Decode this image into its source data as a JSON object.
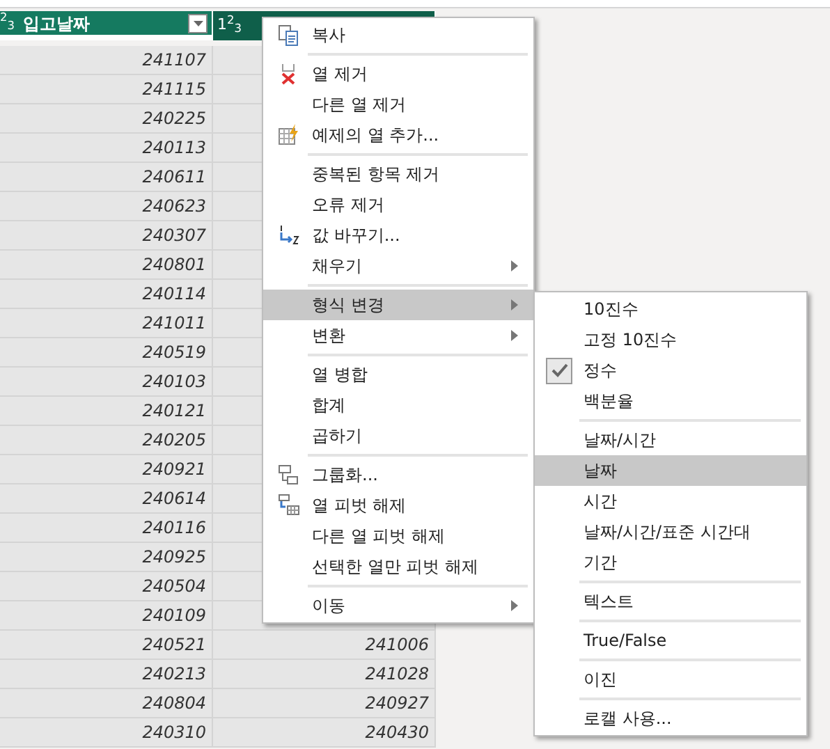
{
  "table": {
    "columns": [
      {
        "type_badge": "$^{2}$$_{3}$",
        "label": "입고날짜"
      },
      {
        "type_badge": "1$^{2}$$_{3}$"
      }
    ],
    "rows": [
      {
        "cells": [
          "241107"
        ]
      },
      {
        "cells": [
          "241115"
        ]
      },
      {
        "cells": [
          "240225"
        ]
      },
      {
        "cells": [
          "240113"
        ]
      },
      {
        "cells": [
          "240611"
        ]
      },
      {
        "cells": [
          "240623"
        ]
      },
      {
        "cells": [
          "240307"
        ]
      },
      {
        "cells": [
          "240801"
        ]
      },
      {
        "cells": [
          "240114"
        ]
      },
      {
        "cells": [
          "241011"
        ]
      },
      {
        "cells": [
          "240519"
        ]
      },
      {
        "cells": [
          "240103"
        ]
      },
      {
        "cells": [
          "240121"
        ]
      },
      {
        "cells": [
          "240205"
        ]
      },
      {
        "cells": [
          "240921"
        ]
      },
      {
        "cells": [
          "240614"
        ]
      },
      {
        "cells": [
          "240116"
        ]
      },
      {
        "cells": [
          "240925"
        ]
      },
      {
        "cells": [
          "240504"
        ]
      },
      {
        "cells": [
          "240109"
        ]
      },
      {
        "cells": [
          "240521",
          "241006"
        ]
      },
      {
        "cells": [
          "240213",
          "241028"
        ]
      },
      {
        "cells": [
          "240804",
          "240927"
        ]
      },
      {
        "cells": [
          "240310",
          "240430"
        ]
      }
    ]
  },
  "context_menu": {
    "groups": [
      [
        {
          "label": "복사",
          "kind": "copy",
          "submenu": false,
          "selected": false
        }
      ],
      [
        {
          "label": "열 제거",
          "kind": "delete",
          "submenu": false,
          "selected": false
        },
        {
          "label": "다른 열 제거",
          "kind": "plain",
          "submenu": false,
          "selected": false
        },
        {
          "label": "예제의 열 추가...",
          "kind": "example",
          "submenu": false,
          "selected": false
        }
      ],
      [
        {
          "label": "중복된 항목 제거",
          "kind": "plain",
          "submenu": false,
          "selected": false
        },
        {
          "label": "오류 제거",
          "kind": "plain",
          "submenu": false,
          "selected": false
        },
        {
          "label": "값 바꾸기...",
          "kind": "replace",
          "submenu": false,
          "selected": false
        },
        {
          "label": "채우기",
          "kind": "plain",
          "submenu": true,
          "selected": false
        }
      ],
      [
        {
          "label": "형식 변경",
          "kind": "plain",
          "submenu": true,
          "selected": true
        },
        {
          "label": "변환",
          "kind": "plain",
          "submenu": true,
          "selected": false
        }
      ],
      [
        {
          "label": "열 병합",
          "kind": "plain",
          "submenu": false,
          "selected": false
        },
        {
          "label": "합계",
          "kind": "plain",
          "submenu": false,
          "selected": false
        },
        {
          "label": "곱하기",
          "kind": "plain",
          "submenu": false,
          "selected": false
        }
      ],
      [
        {
          "label": "그룹화...",
          "kind": "group",
          "submenu": false,
          "selected": false
        },
        {
          "label": "열 피벗 해제",
          "kind": "unpivot",
          "submenu": false,
          "selected": false
        },
        {
          "label": "다른 열 피벗 해제",
          "kind": "plain",
          "submenu": false,
          "selected": false
        },
        {
          "label": "선택한 열만 피벗 해제",
          "kind": "plain",
          "submenu": false,
          "selected": false
        }
      ],
      [
        {
          "label": "이동",
          "kind": "plain",
          "submenu": true,
          "selected": false
        }
      ]
    ]
  },
  "type_submenu": {
    "groups": [
      [
        {
          "label": "10진수",
          "checked": false,
          "selected": false
        },
        {
          "label": "고정 10진수",
          "checked": false,
          "selected": false
        },
        {
          "label": "정수",
          "checked": true,
          "selected": false
        },
        {
          "label": "백분율",
          "checked": false,
          "selected": false
        }
      ],
      [
        {
          "label": "날짜/시간",
          "checked": false,
          "selected": false
        },
        {
          "label": "날짜",
          "checked": false,
          "selected": true
        },
        {
          "label": "시간",
          "checked": false,
          "selected": false
        },
        {
          "label": "날짜/시간/표준 시간대",
          "checked": false,
          "selected": false
        },
        {
          "label": "기간",
          "checked": false,
          "selected": false
        }
      ],
      [
        {
          "label": "텍스트",
          "checked": false,
          "selected": false
        }
      ],
      [
        {
          "label": "True/False",
          "checked": false,
          "selected": false
        }
      ],
      [
        {
          "label": "이진",
          "checked": false,
          "selected": false
        }
      ],
      [
        {
          "label": "로캘 사용...",
          "checked": false,
          "selected": false
        }
      ]
    ]
  }
}
